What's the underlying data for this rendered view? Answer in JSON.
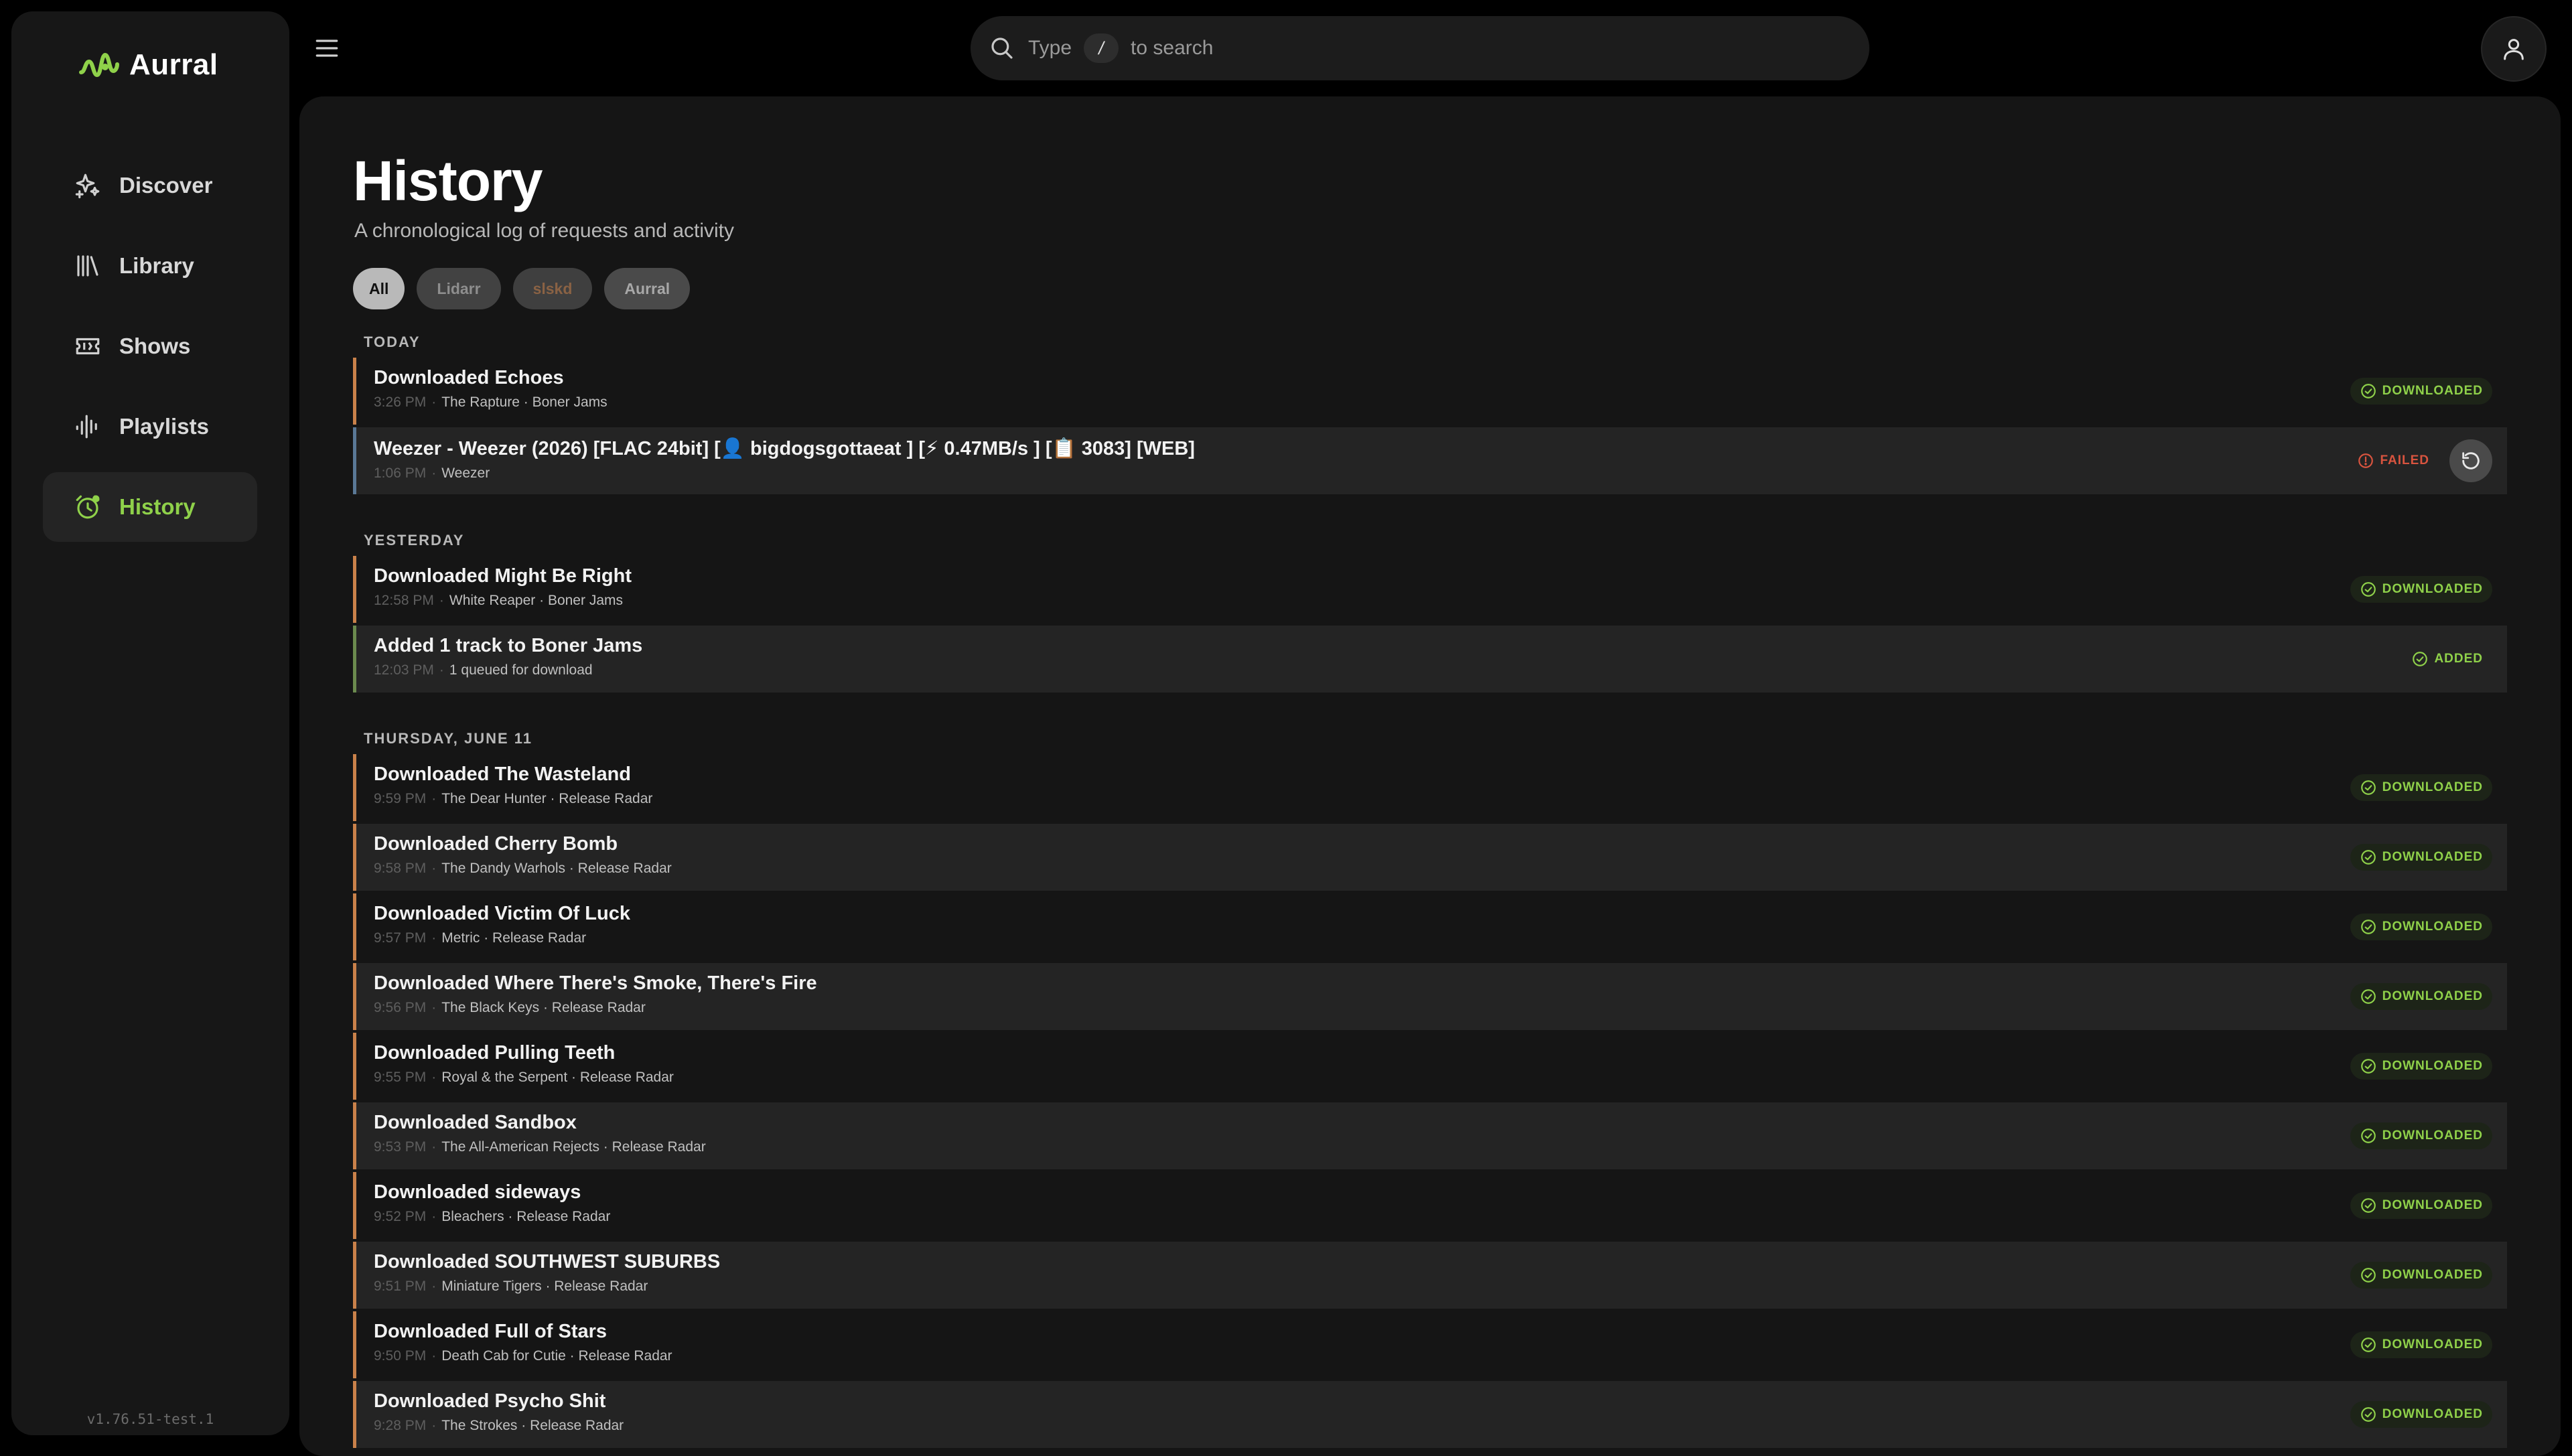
{
  "app": {
    "name": "Aurral",
    "version": "v1.76.51-test.1"
  },
  "nav": [
    {
      "label": "Discover",
      "icon": "sparkle-icon",
      "active": false
    },
    {
      "label": "Library",
      "icon": "library-icon",
      "active": false
    },
    {
      "label": "Shows",
      "icon": "ticket-icon",
      "active": false
    },
    {
      "label": "Playlists",
      "icon": "waveform-icon",
      "active": false
    },
    {
      "label": "History",
      "icon": "history-clock-icon",
      "active": true
    }
  ],
  "search": {
    "prefix": "Type",
    "key": "/",
    "suffix": "to search"
  },
  "page": {
    "title": "History",
    "subtitle": "A chronological log of requests and activity"
  },
  "filters": [
    {
      "label": "All",
      "active": true
    },
    {
      "label": "Lidarr",
      "active": false
    },
    {
      "label": "slskd",
      "active": false
    },
    {
      "label": "Aurral",
      "active": false
    }
  ],
  "sections": [
    {
      "label": "TODAY",
      "rows": [
        {
          "title": "Downloaded Echoes",
          "time": "3:26 PM",
          "meta": "The Rapture · Boner Jams",
          "status": "DOWNLOADED",
          "kind": "downloaded"
        },
        {
          "title": "Weezer - Weezer (2026) [FLAC 24bit] [👤 bigdogsgottaeat ] [⚡ 0.47MB/s ] [📋 3083] [WEB]",
          "time": "1:06 PM",
          "meta": "Weezer",
          "status": "FAILED",
          "kind": "failed"
        }
      ]
    },
    {
      "label": "YESTERDAY",
      "rows": [
        {
          "title": "Downloaded Might Be Right",
          "time": "12:58 PM",
          "meta": "White Reaper · Boner Jams",
          "status": "DOWNLOADED",
          "kind": "downloaded"
        },
        {
          "title": "Added 1 track to Boner Jams",
          "time": "12:03 PM",
          "meta": "1 queued for download",
          "status": "ADDED",
          "kind": "added"
        }
      ]
    },
    {
      "label": "THURSDAY, JUNE 11",
      "rows": [
        {
          "title": "Downloaded The Wasteland",
          "time": "9:59 PM",
          "meta": "The Dear Hunter · Release Radar",
          "status": "DOWNLOADED",
          "kind": "downloaded"
        },
        {
          "title": "Downloaded Cherry Bomb",
          "time": "9:58 PM",
          "meta": "The Dandy Warhols · Release Radar",
          "status": "DOWNLOADED",
          "kind": "downloaded"
        },
        {
          "title": "Downloaded Victim Of Luck",
          "time": "9:57 PM",
          "meta": "Metric · Release Radar",
          "status": "DOWNLOADED",
          "kind": "downloaded"
        },
        {
          "title": "Downloaded Where There's Smoke, There's Fire",
          "time": "9:56 PM",
          "meta": "The Black Keys · Release Radar",
          "status": "DOWNLOADED",
          "kind": "downloaded"
        },
        {
          "title": "Downloaded Pulling Teeth",
          "time": "9:55 PM",
          "meta": "Royal & the Serpent · Release Radar",
          "status": "DOWNLOADED",
          "kind": "downloaded"
        },
        {
          "title": "Downloaded Sandbox",
          "time": "9:53 PM",
          "meta": "The All-American Rejects · Release Radar",
          "status": "DOWNLOADED",
          "kind": "downloaded"
        },
        {
          "title": "Downloaded sideways",
          "time": "9:52 PM",
          "meta": "Bleachers · Release Radar",
          "status": "DOWNLOADED",
          "kind": "downloaded"
        },
        {
          "title": "Downloaded SOUTHWEST SUBURBS",
          "time": "9:51 PM",
          "meta": "Miniature Tigers · Release Radar",
          "status": "DOWNLOADED",
          "kind": "downloaded"
        },
        {
          "title": "Downloaded Full of Stars",
          "time": "9:50 PM",
          "meta": "Death Cab for Cutie · Release Radar",
          "status": "DOWNLOADED",
          "kind": "downloaded"
        },
        {
          "title": "Downloaded Psycho Shit",
          "time": "9:28 PM",
          "meta": "The Strokes · Release Radar",
          "status": "DOWNLOADED",
          "kind": "downloaded"
        }
      ]
    }
  ],
  "colors": {
    "accent": "#8fd14a",
    "failed": "#d9543f",
    "background": "#000000",
    "panel": "#151515"
  }
}
